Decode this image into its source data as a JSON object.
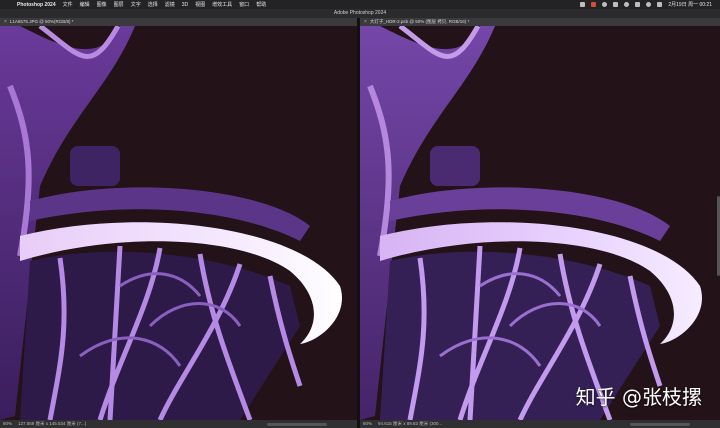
{
  "menubar": {
    "app_name": "Photoshop 2024",
    "menus": [
      "文件",
      "编辑",
      "图像",
      "图层",
      "文字",
      "选择",
      "滤镜",
      "3D",
      "视图",
      "增效工具",
      "窗口",
      "帮助"
    ],
    "clock": "2月19日 周一 00:21"
  },
  "window": {
    "title": "Adobe Photoshop 2024"
  },
  "left_doc": {
    "tab_label": "L1A6575.JPG @ 50%(RGB/8) *",
    "zoom": "50%",
    "doc_info": "127.559 厘米 x 145.534 厘米 (7...)"
  },
  "right_doc": {
    "tab_label": "大灯子_HDR-2.psb @ 50% (图层 拷贝, RGB/16) *",
    "zoom": "50%",
    "doc_info": "94.615 厘米 x 89.83 厘米 (300..."
  },
  "watermark": "知乎 @张枝摞"
}
